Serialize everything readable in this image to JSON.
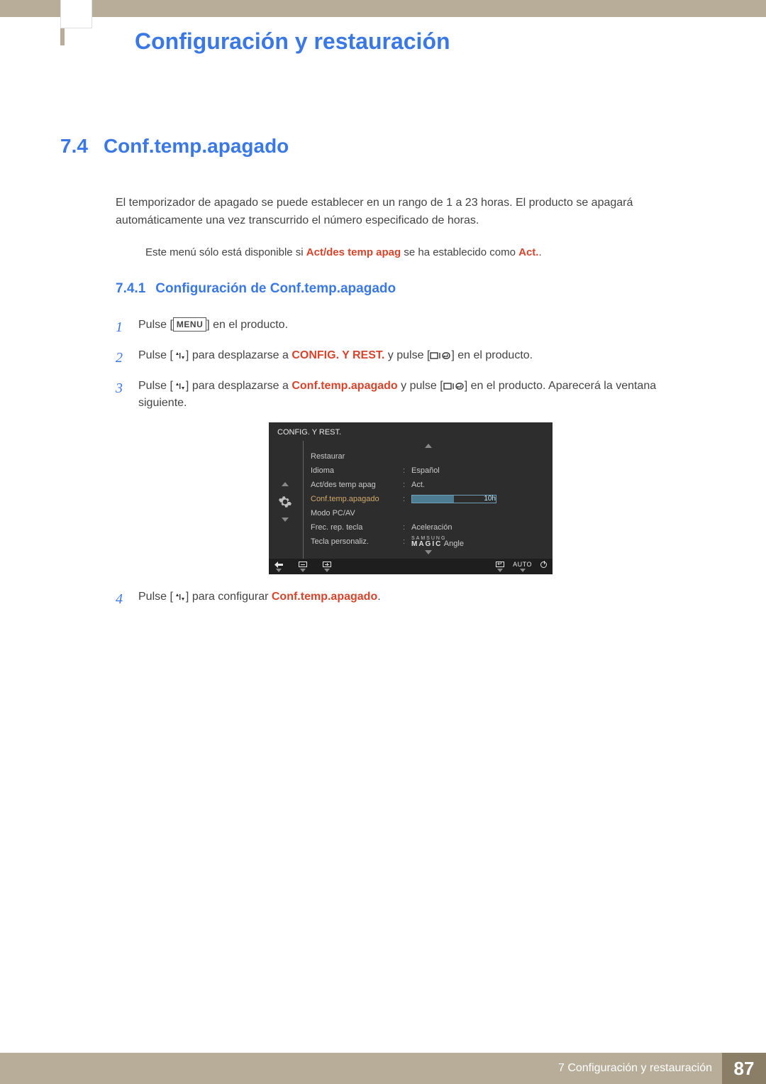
{
  "chapter_title": "Configuración y restauración",
  "section": {
    "num": "7.4",
    "title": "Conf.temp.apagado"
  },
  "intro": "El temporizador de apagado se puede establecer en un rango de 1 a 23 horas. El producto se apagará automáticamente una vez transcurrido el número especificado de horas.",
  "note": {
    "pre": "Este menú sólo está disponible si ",
    "hl1": "Act/des temp apag",
    "mid": " se ha establecido como ",
    "hl2": "Act.",
    "post": "."
  },
  "subsection": {
    "num": "7.4.1",
    "title": "Configuración de Conf.temp.apagado"
  },
  "steps": {
    "s1": {
      "n": "1",
      "a": "Pulse [",
      "menu": "MENU",
      "b": "] en el producto."
    },
    "s2": {
      "n": "2",
      "a": "Pulse [",
      "b": "] para desplazarse a ",
      "hl": "CONFIG. Y REST.",
      "c": " y pulse [",
      "d": "] en el producto."
    },
    "s3": {
      "n": "3",
      "a": "Pulse [",
      "b": "] para desplazarse a ",
      "hl": "Conf.temp.apagado",
      "c": " y pulse [",
      "d": "] en el producto. Aparecerá la ventana siguiente."
    },
    "s4": {
      "n": "4",
      "a": "Pulse [",
      "b": "] para configurar ",
      "hl": "Conf.temp.apagado",
      "c": "."
    }
  },
  "osd": {
    "title": "CONFIG. Y REST.",
    "rows": {
      "restaurar": {
        "label": "Restaurar"
      },
      "idioma": {
        "label": "Idioma",
        "val": "Español"
      },
      "actdes": {
        "label": "Act/des temp apag",
        "val": "Act."
      },
      "conftemp": {
        "label": "Conf.temp.apagado",
        "slider_val": "10h"
      },
      "modopcav": {
        "label": "Modo PC/AV"
      },
      "frecrep": {
        "label": "Frec. rep. tecla",
        "val": "Aceleración"
      },
      "tecla": {
        "label": "Tecla personaliz.",
        "sup": "SAMSUNG",
        "main": "MAGIC",
        "suf": "Angle"
      }
    },
    "footer_auto": "AUTO"
  },
  "footer": {
    "label": "7 Configuración y restauración",
    "page": "87"
  }
}
